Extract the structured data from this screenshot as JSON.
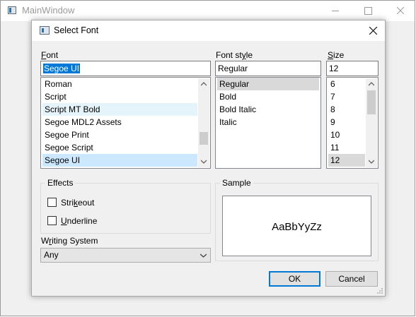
{
  "main_window": {
    "title": "MainWindow"
  },
  "dialog": {
    "title": "Select Font",
    "font": {
      "label_first": "F",
      "label_rest": "ont",
      "value": "Segoe UI",
      "items": [
        "Roman",
        "Script",
        "Script MT Bold",
        "Segoe MDL2 Assets",
        "Segoe Print",
        "Segoe Script",
        "Segoe UI"
      ],
      "selected": "Segoe UI"
    },
    "font_style": {
      "label_pre": "Font st",
      "label_ul": "y",
      "label_post": "le",
      "value": "Regular",
      "items": [
        "Regular",
        "Bold",
        "Bold Italic",
        "Italic"
      ],
      "selected": "Regular"
    },
    "size": {
      "label_ul": "S",
      "label_rest": "ize",
      "value": "12",
      "items": [
        "6",
        "7",
        "8",
        "9",
        "10",
        "11",
        "12"
      ],
      "selected": "12"
    },
    "effects": {
      "title": "Effects",
      "strikeout_pre": "Stri",
      "strikeout_ul": "k",
      "strikeout_post": "eout",
      "strikeout_checked": false,
      "underline_ul": "U",
      "underline_rest": "nderline",
      "underline_checked": false
    },
    "sample": {
      "title": "Sample",
      "text": "AaBbYyZz"
    },
    "writing_system": {
      "label_pre": "W",
      "label_ul": "r",
      "label_post": "iting System",
      "value": "Any"
    },
    "buttons": {
      "ok": "OK",
      "cancel": "Cancel"
    }
  },
  "colors": {
    "accent": "#0078d7",
    "list_selected": "#cce8ff",
    "list_hover": "#e5f3fb",
    "window_bg": "#f0f0f0"
  }
}
